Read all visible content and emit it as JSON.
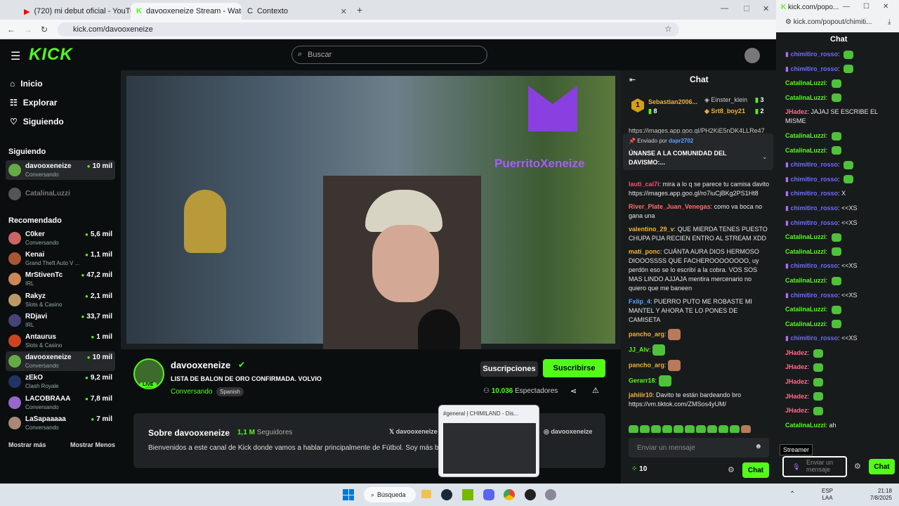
{
  "browser": {
    "tabs": [
      "(720) mi debut oficial - YouTube",
      "davooxeneize Stream - Watch Li",
      "Contexto"
    ],
    "url": "kick.com/davooxeneize"
  },
  "kick": {
    "search_placeholder": "Buscar",
    "nav": [
      "Inicio",
      "Explorar",
      "Siguiendo"
    ],
    "siguiendo_title": "Siguiendo",
    "recomendado_title": "Recomendado",
    "mostrar_mas": "Mostrar más",
    "mostrar_menos": "Mostrar Menos",
    "following": [
      {
        "name": "davooxeneize",
        "cat": "Conversando",
        "viewers": "10 mil"
      },
      {
        "name": "CatalinaLuzzi",
        "cat": "",
        "viewers": ""
      }
    ],
    "recommended": [
      {
        "name": "C0ker",
        "cat": "Conversando",
        "viewers": "5,6 mil"
      },
      {
        "name": "Kenai",
        "cat": "Grand Theft Auto V ...",
        "viewers": "1,1 mil"
      },
      {
        "name": "MrStivenTc",
        "cat": "IRL",
        "viewers": "47,2 mil"
      },
      {
        "name": "Rakyz",
        "cat": "Slots & Casino",
        "viewers": "2,1 mil"
      },
      {
        "name": "RDjavi",
        "cat": "IRL",
        "viewers": "33,7 mil"
      },
      {
        "name": "Antaurus",
        "cat": "Slots & Casino",
        "viewers": "1 mil"
      },
      {
        "name": "davooxeneize",
        "cat": "Conversando",
        "viewers": "10 mil"
      },
      {
        "name": "zEkO",
        "cat": "Clash Royale",
        "viewers": "9,2 mil"
      },
      {
        "name": "LACOBRAAA",
        "cat": "Conversando",
        "viewers": "7,8 mil"
      },
      {
        "name": "LaSapaaaaa",
        "cat": "Conversando",
        "viewers": "7 mil"
      }
    ]
  },
  "stream": {
    "overlay_text": "PuerritoXeneize",
    "streamer": "davooxeneize",
    "title": "LISTA DE BALON DE ORO CONFIRMADA. VOLVIO EL D'YB...",
    "category": "Conversando",
    "lang": "Spanish",
    "live": "LIVE",
    "subs_btn": "Suscripciones",
    "subscribe_btn": "Suscribirse",
    "viewers": "10.036",
    "viewers_label": "Espectadores",
    "about_title": "Sobre davooxeneize",
    "followers": "1,1 M",
    "followers_label": "Seguidores",
    "about_text": "Bienvenidos a este canal de Kick donde vamos a hablar principalmente de Fútbol. Soy más bo",
    "social": [
      "davooxeneize",
      "davooxeneize"
    ]
  },
  "discord_preview": "#general | CHIMILAND - Dis...",
  "chat": {
    "title": "Chat",
    "top": [
      {
        "name": "Sebastian2006...",
        "n": "8"
      },
      {
        "name": "Einster_klein",
        "n": "3"
      },
      {
        "name": "Srt8_boy21",
        "n": "2"
      }
    ],
    "pin_by": "Enviado por",
    "pin_user": "dapr2702",
    "pin_text": "ÚNANSE A LA COMUNIDAD DEL DAVISMO:...",
    "url_top": "https://images.app.goo.gl/PH2KiE5nDK4LLRe47",
    "messages": [
      {
        "user": "lauti_cai7i",
        "color": "#ff4d6d",
        "text": "mira a lo q se parece tu camisa davito https://images.app.goo.gl/ro7iuCjBKg2PS1Ht8"
      },
      {
        "user": "River_Plate_Juan_Venegas",
        "color": "#ff6b6b",
        "text": "como va boca no gana una"
      },
      {
        "user": "valentino_29_v",
        "color": "#f0b23c",
        "text": "QUE MIERDA TENES PUESTO CHUPA PIJA RECIEN ENTRO AL STREAM XDD"
      },
      {
        "user": "mati_ponc",
        "color": "#f0b23c",
        "text": "CUÁNTA AURA DIOS HERMOSO DIOOOSSSS QUE FACHEROOOOOOOO, uy perdón eso se lo escribí a la cobra. VOS SOS MAS LINDO AJJAJA mentira mercenario no quiero que me baneen"
      },
      {
        "user": "Fxlip_4",
        "color": "#5aa0ff",
        "text": "PUERRO PUTO ME ROBASTE MI MANTEL Y AHORA TE LO PONES DE CAMISETA"
      },
      {
        "user": "pancho_arg",
        "color": "#f0b23c",
        "text": ""
      },
      {
        "user": "JJ_Alv",
        "color": "#53fc18",
        "text": ""
      },
      {
        "user": "pancho_arg",
        "color": "#f0b23c",
        "text": ""
      },
      {
        "user": "Gerarr18",
        "color": "#53fc18",
        "text": ""
      },
      {
        "user": "jahiiir10",
        "color": "#f0b23c",
        "text": "Davito te están bardeando bro https://vm.tiktok.com/ZMSos4yUM/"
      }
    ],
    "input_placeholder": "Enviar un mensaje",
    "points": "10",
    "send": "Chat"
  },
  "popout": {
    "url": "kick.com/popout/chimiti...",
    "title": "Chat",
    "tab": "kick.com/popo...",
    "streamer_tip": "Streamer",
    "input_placeholder": "Enviar un mensaje",
    "send": "Chat",
    "messages": [
      {
        "user": "chimitiro_rosso",
        "text": ""
      },
      {
        "user": "chimitiro_rosso",
        "text": ""
      },
      {
        "user": "CatalinaLuzzi",
        "text": ""
      },
      {
        "user": "CatalinaLuzzi",
        "text": ""
      },
      {
        "user": "JHadez",
        "text": "JAJAJ SE ESCRIBE EL MISME"
      },
      {
        "user": "CatalinaLuzzi",
        "text": ""
      },
      {
        "user": "CatalinaLuzzi",
        "text": ""
      },
      {
        "user": "chimitiro_rosso",
        "text": ""
      },
      {
        "user": "chimitiro_rosso",
        "text": ""
      },
      {
        "user": "chimitiro_rosso",
        "text": "X"
      },
      {
        "user": "chimitiro_rosso",
        "text": "<<XS"
      },
      {
        "user": "chimitiro_rosso",
        "text": "<<XS"
      },
      {
        "user": "CatalinaLuzzi",
        "text": ""
      },
      {
        "user": "CatalinaLuzzi",
        "text": ""
      },
      {
        "user": "chimitiro_rosso",
        "text": "<<XS"
      },
      {
        "user": "CatalinaLuzzi",
        "text": ""
      },
      {
        "user": "chimitiro_rosso",
        "text": "<<XS"
      },
      {
        "user": "CatalinaLuzzi",
        "text": ""
      },
      {
        "user": "CatalinaLuzzi",
        "text": ""
      },
      {
        "user": "chimitiro_rosso",
        "text": "<<XS"
      },
      {
        "user": "JHadez",
        "text": ""
      },
      {
        "user": "JHadez",
        "text": ""
      },
      {
        "user": "JHadez",
        "text": ""
      },
      {
        "user": "JHadez",
        "text": ""
      },
      {
        "user": "JHadez",
        "text": ""
      },
      {
        "user": "CatalinaLuzzi",
        "text": "ah"
      }
    ]
  },
  "taskbar": {
    "search": "Búsqueda",
    "lang": "ESP",
    "lang2": "LAA",
    "time": "21:18",
    "date": "7/8/2025"
  },
  "colors": {
    "accent": "#53fc18",
    "bg": "#0b0e0f",
    "chat_bg": "#181b1c"
  }
}
